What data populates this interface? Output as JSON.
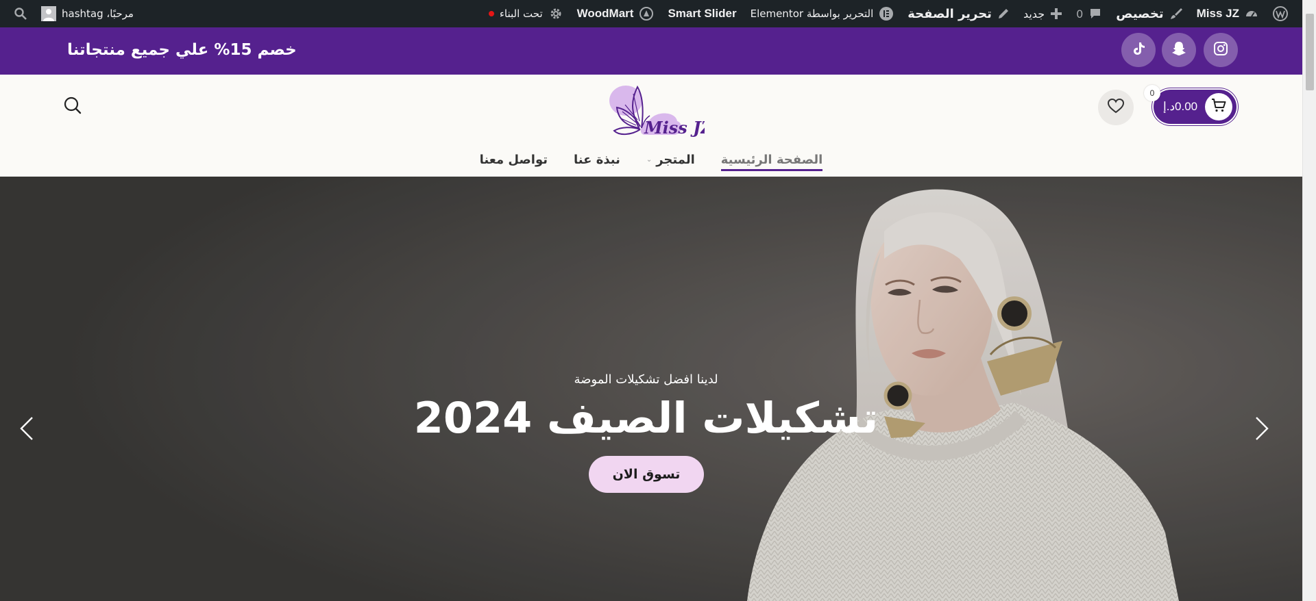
{
  "admin_bar": {
    "site_name": "Miss JZ",
    "customize": "تخصيص",
    "comments_count": "0",
    "new": "جديد",
    "edit_page": "تحرير الصفحة",
    "edit_elementor": "التحرير بواسطة Elementor",
    "smart_slider": "Smart Slider",
    "woodmart": "WoodMart",
    "maintenance": "تحت البناء",
    "greeting": "مرحبًا، hashtag"
  },
  "promo": {
    "text": "خصم 15% علي جميع منتجاتنا"
  },
  "header": {
    "logo_text": "Miss JZ",
    "cart_amount": "0.00د.إ",
    "cart_count": "0"
  },
  "nav": {
    "items": [
      {
        "label": "الصفحة الرئيسية"
      },
      {
        "label": "المتجر"
      },
      {
        "label": "نبذة عنا"
      },
      {
        "label": "تواصل معنا"
      }
    ]
  },
  "hero": {
    "subtitle": "لدينا افضل تشكيلات الموضة",
    "title": "تشكيلات الصيف 2024",
    "cta": "تسوق الان"
  },
  "colors": {
    "brand_purple": "#55218e",
    "admin_bar": "#1d2327",
    "cta_pink": "#f1d6f1"
  },
  "icons": {
    "admin": [
      "wordpress-icon",
      "dashboard-icon",
      "brush-icon",
      "comment-icon",
      "plus-icon",
      "pencil-icon",
      "elementor-icon",
      "woodmart-icon",
      "gear-icon",
      "search-icon"
    ],
    "header": [
      "search-icon",
      "heart-icon",
      "cart-icon",
      "instagram-icon",
      "snapchat-icon",
      "tiktok-icon"
    ]
  }
}
